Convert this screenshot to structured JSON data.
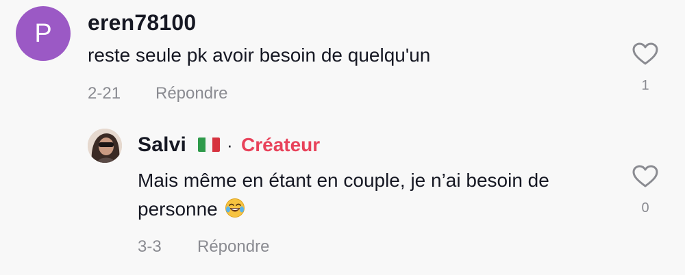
{
  "comments": [
    {
      "avatar_letter": "P",
      "avatar_color": "#9b59c5",
      "username": "eren78100",
      "text": "reste seule pk avoir besoin de quelqu'un",
      "date": "2-21",
      "reply_label": "Répondre",
      "like_count": "1",
      "like_icon": "heart-outline-icon",
      "reply": {
        "username": "Salvi",
        "flag": "italy-flag",
        "separator": "·",
        "badge": "Créateur",
        "badge_color": "#e8425a",
        "text_line1": "Mais même en étant en couple, je n’ai besoin de",
        "text_line2": "personne",
        "emoji": "face-with-tears-of-joy",
        "date": "3-3",
        "reply_label": "Répondre",
        "like_count": "0",
        "like_icon": "heart-outline-icon"
      }
    }
  ]
}
